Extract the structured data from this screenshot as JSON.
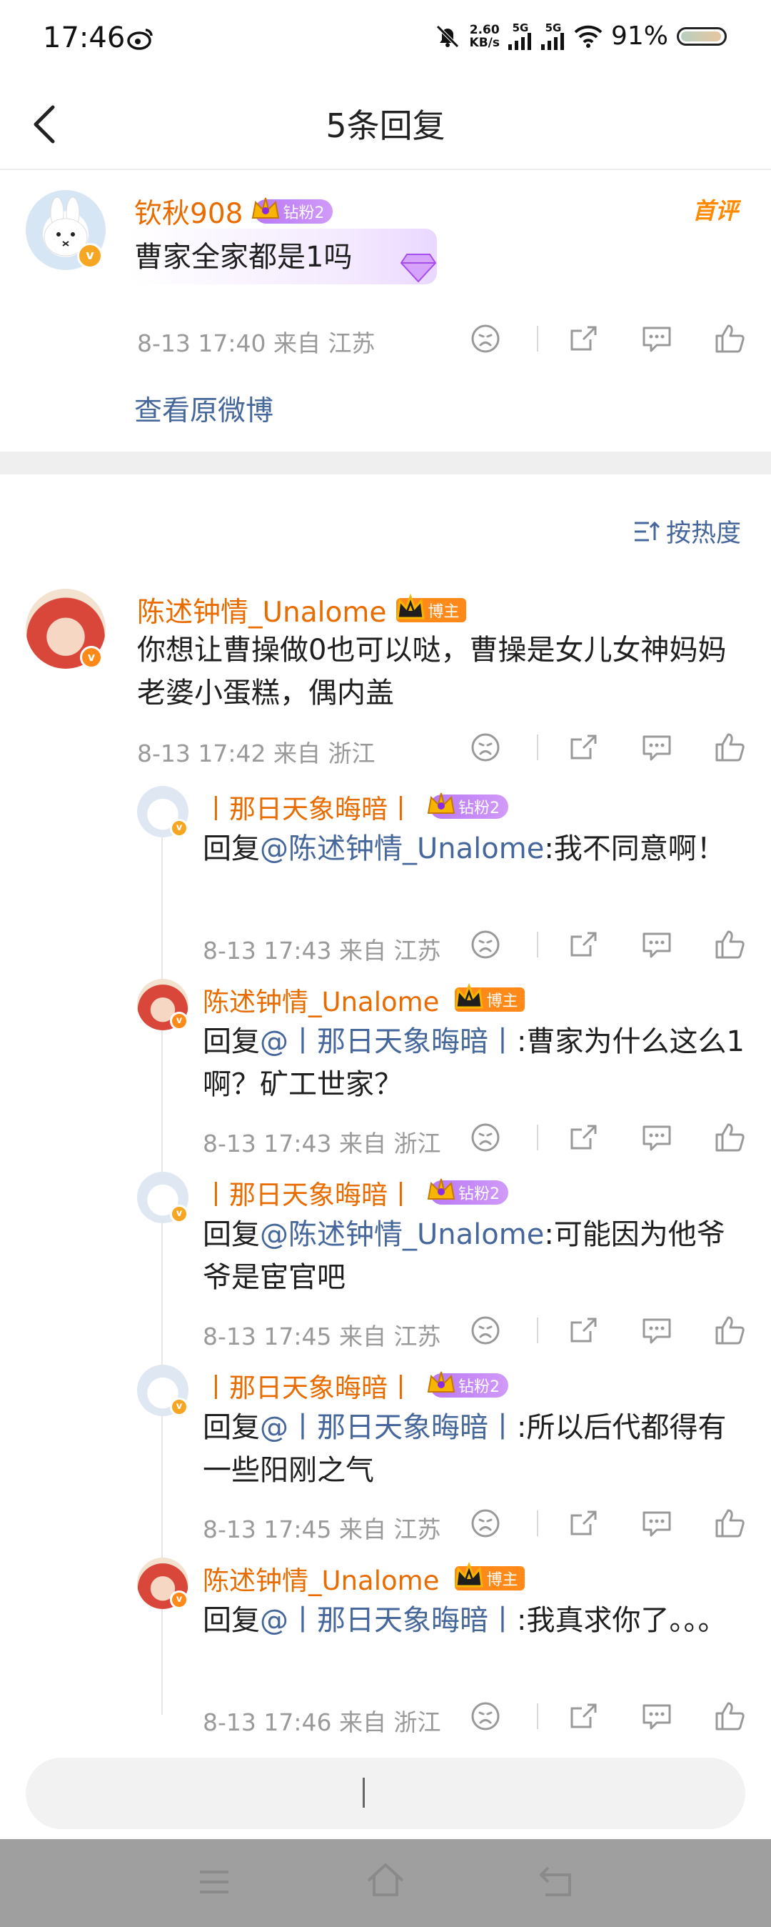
{
  "status_bar": {
    "time": "17:46",
    "speed_top": "2.60",
    "speed_bottom": "KB/s",
    "net1": "5G",
    "net2": "5G",
    "battery": "91%"
  },
  "header": {
    "title": "5条回复"
  },
  "root_comment": {
    "user": "钦秋908",
    "badge": "钻粉2",
    "tag": "首评",
    "text": "曹家全家都是1吗",
    "meta": "8-13 17:40  来自 江苏",
    "view_original": "查看原微博"
  },
  "sort_label": "按热度",
  "main_comment": {
    "user": "陈述钟情_Unalome",
    "badge": "博主",
    "text": "你想让曹操做0也可以哒，曹操是女儿女神妈妈老婆小蛋糕，偶内盖",
    "meta": "8-13 17:42  来自 浙江"
  },
  "replies": [
    {
      "user": "丨那日天象晦暗丨",
      "badge": "钻粉2",
      "reply_prefix": "回复",
      "mention": "@陈述钟情_Unalome",
      "text": ":我不同意啊！",
      "meta": "8-13 17:43  来自 江苏"
    },
    {
      "user": "陈述钟情_Unalome",
      "badge": "博主",
      "reply_prefix": "回复",
      "mention": "@丨那日天象晦暗丨",
      "text": ":曹家为什么这么1啊？矿工世家？",
      "meta": "8-13 17:43  来自 浙江"
    },
    {
      "user": "丨那日天象晦暗丨",
      "badge": "钻粉2",
      "reply_prefix": "回复",
      "mention": "@陈述钟情_Unalome",
      "text": ":可能因为他爷爷是宦官吧",
      "meta": "8-13 17:45  来自 江苏"
    },
    {
      "user": "丨那日天象晦暗丨",
      "badge": "钻粉2",
      "reply_prefix": "回复",
      "mention": "@丨那日天象晦暗丨",
      "text": ":所以后代都得有一些阳刚之气",
      "meta": "8-13 17:45  来自 江苏"
    },
    {
      "user": "陈述钟情_Unalome",
      "badge": "博主",
      "reply_prefix": "回复",
      "mention": "@丨那日天象晦暗丨",
      "text": ":我真求你了。。。",
      "meta": "8-13 17:46  来自 浙江"
    }
  ],
  "icon_names": [
    "dislike-icon",
    "share-icon",
    "comment-icon",
    "like-icon"
  ],
  "colors": {
    "username": "#e86c00",
    "mention": "#46679b",
    "meta": "#9a9a9a"
  }
}
